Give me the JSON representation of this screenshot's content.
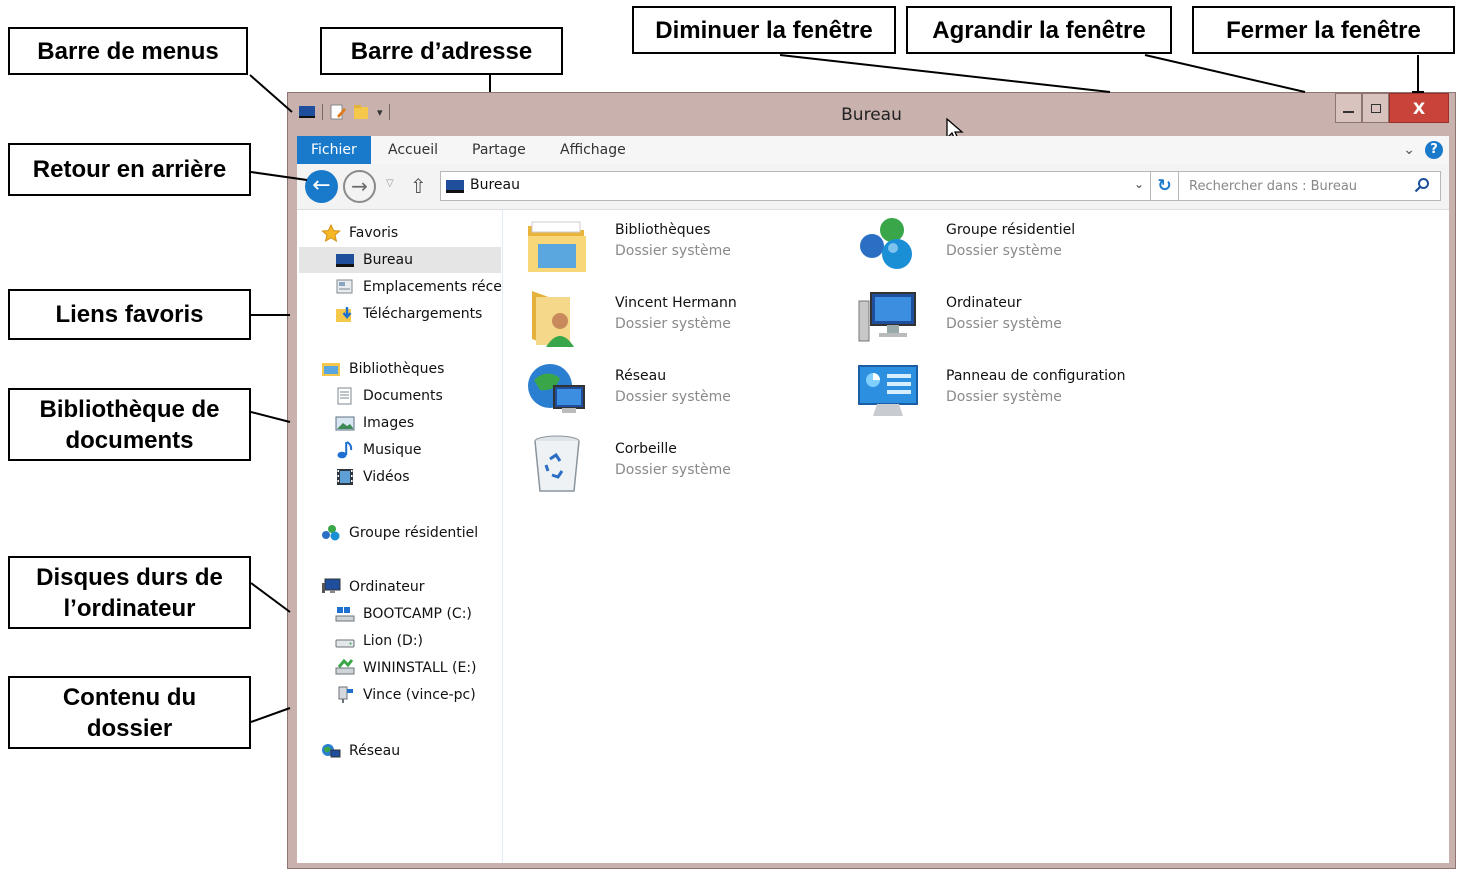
{
  "callouts": {
    "menu_bar": "Barre de menus",
    "address_bar": "Barre d’adresse",
    "minimize": "Diminuer la fenêtre",
    "maximize": "Agrandir la fenêtre",
    "close": "Fermer la fenêtre",
    "back": "Retour en arrière",
    "favorites": "Liens favoris",
    "doc_library_l1": "Bibliothèque de",
    "doc_library_l2": "documents",
    "disks_l1": "Disques durs de",
    "disks_l2": "l’ordinateur",
    "content_l1": "Contenu du",
    "content_l2": "dossier"
  },
  "window": {
    "title": "Bureau",
    "close_glyph": "X"
  },
  "ribbon": {
    "tabs": [
      "Fichier",
      "Accueil",
      "Partage",
      "Affichage"
    ],
    "help_glyph": "?",
    "expand_glyph": "⌄"
  },
  "navbar": {
    "address_value": "Bureau",
    "search_placeholder": "Rechercher dans : Bureau",
    "back_glyph": "←",
    "forward_glyph": "→",
    "up_glyph": "⇧",
    "refresh_glyph": "↻"
  },
  "sidebar": {
    "favorites": {
      "label": "Favoris",
      "icon": "star-icon"
    },
    "favorites_items": [
      {
        "label": "Bureau",
        "icon": "desktop-icon"
      },
      {
        "label": "Emplacements récents",
        "icon": "recent-places-icon"
      },
      {
        "label": "Téléchargements",
        "icon": "downloads-icon"
      }
    ],
    "libraries": {
      "label": "Bibliothèques",
      "icon": "libraries-icon"
    },
    "libraries_items": [
      {
        "label": "Documents",
        "icon": "document-icon"
      },
      {
        "label": "Images",
        "icon": "image-icon"
      },
      {
        "label": "Musique",
        "icon": "music-icon"
      },
      {
        "label": "Vidéos",
        "icon": "video-icon"
      }
    ],
    "homegroup": {
      "label": "Groupe résidentiel",
      "icon": "homegroup-icon"
    },
    "computer": {
      "label": "Ordinateur",
      "icon": "computer-icon"
    },
    "computer_items": [
      {
        "label": "BOOTCAMP (C:)",
        "icon": "drive-icon"
      },
      {
        "label": "Lion (D:)",
        "icon": "drive-icon"
      },
      {
        "label": "WININSTALL (E:)",
        "icon": "drive-icon"
      },
      {
        "label": "Vince (vince-pc)",
        "icon": "network-drive-icon"
      }
    ],
    "network": {
      "label": "Réseau",
      "icon": "network-icon"
    }
  },
  "content": {
    "items": [
      {
        "name": "Bibliothèques",
        "type": "Dossier système",
        "icon": "libraries-folder-icon"
      },
      {
        "name": "Groupe résidentiel",
        "type": "Dossier système",
        "icon": "homegroup-icon"
      },
      {
        "name": "Vincent Hermann",
        "type": "Dossier système",
        "icon": "user-folder-icon"
      },
      {
        "name": "Ordinateur",
        "type": "Dossier système",
        "icon": "computer-icon"
      },
      {
        "name": "Réseau",
        "type": "Dossier système",
        "icon": "network-globe-icon"
      },
      {
        "name": "Panneau de configuration",
        "type": "Dossier système",
        "icon": "control-panel-icon"
      },
      {
        "name": "Corbeille",
        "type": "Dossier système",
        "icon": "recycle-bin-icon"
      }
    ]
  },
  "colors": {
    "accent": "#1979ca",
    "window_frame": "#c9b1ad",
    "close_button": "#c8433a"
  }
}
